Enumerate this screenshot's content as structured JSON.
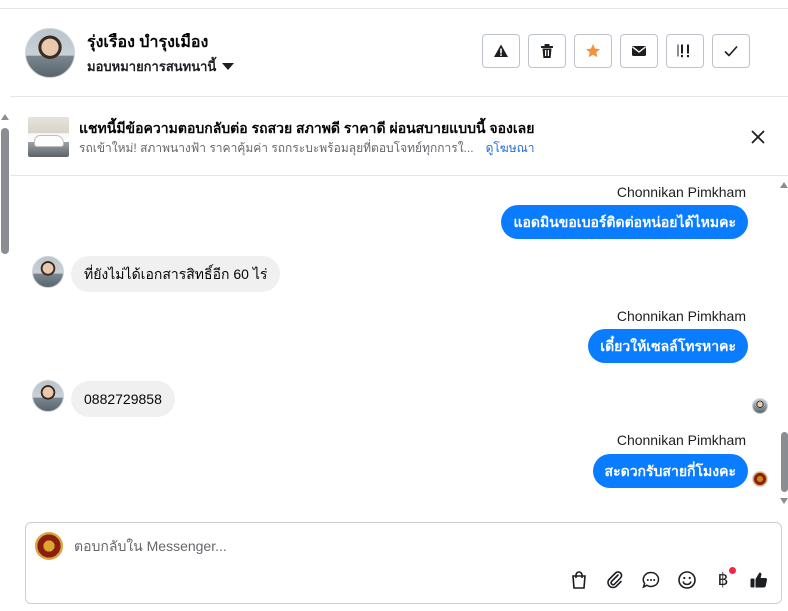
{
  "header": {
    "contact_name": "รุ่งเรือง บำรุงเมือง",
    "assign_label": "มอบหมายการสนทนานี้",
    "actions": [
      {
        "icon": "warning-icon"
      },
      {
        "icon": "trash-icon"
      },
      {
        "icon": "star-icon"
      },
      {
        "icon": "envelope-icon"
      },
      {
        "icon": "follow-up-icon"
      },
      {
        "icon": "check-icon"
      }
    ]
  },
  "ad": {
    "title": "แชทนี้มีข้อความตอบกลับต่อ รถสวย สภาพดี ราคาดี ผ่อนสบายแบบนี้ จองเลย",
    "subtitle": "รถเข้าใหม่! สภาพนางฟ้า ราคาคุ้มค่า รถกระบะพร้อมลุยที่ตอบโจทย์ทุกการใ...",
    "link": "ดูโฆษณา"
  },
  "messages": [
    {
      "direction": "out",
      "sender": "Chonnikan Pimkham",
      "text": "แอดมินขอเบอร์ติดต่อหน่อยได้ไหมคะ"
    },
    {
      "direction": "in",
      "text": "ที่ยังไม่ได้เอกสารสิทธิ์อีก  60  ไร่"
    },
    {
      "direction": "out",
      "sender": "Chonnikan Pimkham",
      "text": "เดี๋ยวให้เซลล์โทรหาคะ"
    },
    {
      "direction": "in",
      "text": "0882729858"
    },
    {
      "direction": "out",
      "sender": "Chonnikan Pimkham",
      "text": "สะดวกรับสายกี่โมงคะ"
    }
  ],
  "composer": {
    "placeholder": "ตอบกลับใน Messenger...",
    "baht_symbol": "฿",
    "tools": [
      "shopping-bag-icon",
      "paperclip-icon",
      "chat-bubble-icon",
      "emoji-icon",
      "baht-icon",
      "thumbs-up-icon"
    ]
  },
  "colors": {
    "accent": "#0a7cff",
    "link": "#216fdb",
    "star": "#f7923b",
    "notify": "#f02849"
  }
}
